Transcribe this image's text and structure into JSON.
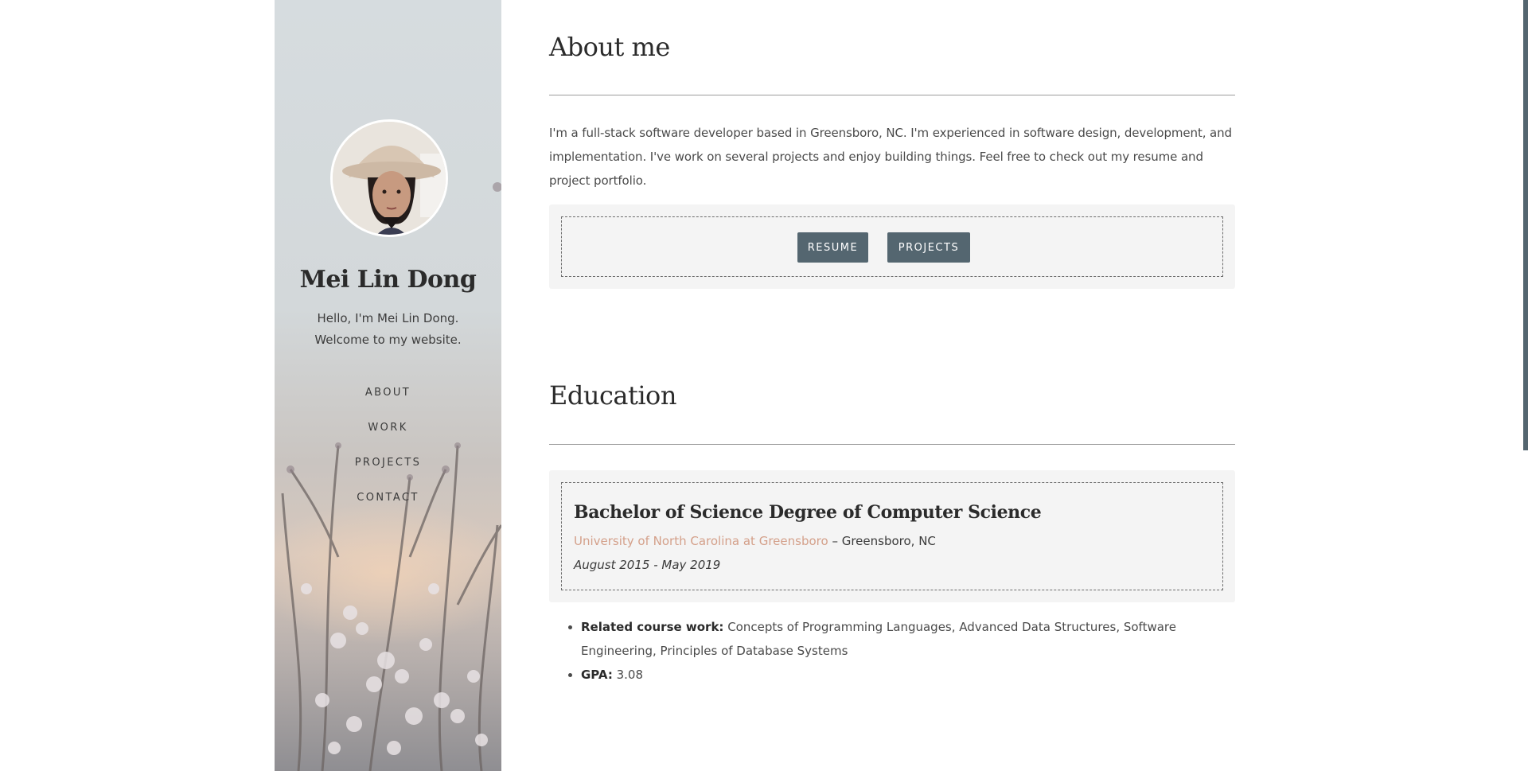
{
  "sidebar": {
    "name": "Mei Lin Dong",
    "tagline_line1": "Hello, I'm Mei Lin Dong.",
    "tagline_line2": "Welcome to my website.",
    "nav": [
      {
        "label": "ABOUT"
      },
      {
        "label": "WORK"
      },
      {
        "label": "PROJECTS"
      },
      {
        "label": "CONTACT"
      }
    ]
  },
  "about": {
    "title": "About me",
    "text": "I'm a full-stack software developer based in Greensboro, NC. I'm experienced in software design, development, and implementation. I've work on several projects and enjoy building things. Feel free to check out my resume and project portfolio.",
    "buttons": {
      "resume": "RESUME",
      "projects": "PROJECTS"
    }
  },
  "education": {
    "title": "Education",
    "degree": "Bachelor of Science Degree of Computer Science",
    "school": "University of North Carolina at Greensboro",
    "location": " – Greensboro, NC",
    "dates": "August 2015 - May 2019",
    "coursework_label": "Related course work:",
    "coursework": " Concepts of Programming Languages, Advanced Data Structures, Software Engineering, Principles of Database Systems",
    "gpa_label": "GPA:",
    "gpa": " 3.08"
  },
  "colors": {
    "button_bg": "#546670",
    "link": "#d4a08a",
    "panel_bg": "#f4f4f4"
  }
}
